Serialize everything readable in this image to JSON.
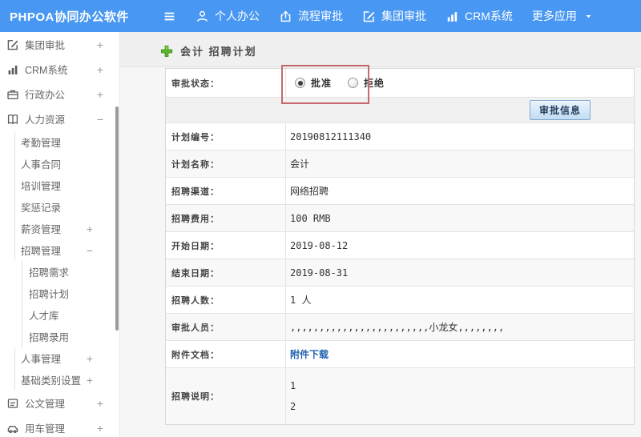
{
  "topbar": {
    "brand": "PHPOA协同办公软件",
    "menu": [
      {
        "label": "个人办公",
        "icon": "user-icon"
      },
      {
        "label": "流程审批",
        "icon": "workflow-icon"
      },
      {
        "label": "集团审批",
        "icon": "edit-square-icon"
      },
      {
        "label": "CRM系统",
        "icon": "bar-chart-icon"
      },
      {
        "label": "更多应用",
        "icon": "caret-down-icon"
      }
    ]
  },
  "sidebar": {
    "items": [
      {
        "label": "集团审批",
        "level": 1,
        "icon": "edit-square-icon",
        "toggle": "+"
      },
      {
        "label": "CRM系统",
        "level": 1,
        "icon": "bar-chart-icon",
        "toggle": "+"
      },
      {
        "label": "行政办公",
        "level": 1,
        "icon": "briefcase-icon",
        "toggle": "+"
      },
      {
        "label": "人力资源",
        "level": 1,
        "icon": "book-icon",
        "toggle": "−"
      },
      {
        "label": "考勤管理",
        "level": 2,
        "toggle": ""
      },
      {
        "label": "人事合同",
        "level": 2,
        "toggle": ""
      },
      {
        "label": "培训管理",
        "level": 2,
        "toggle": ""
      },
      {
        "label": "奖惩记录",
        "level": 2,
        "toggle": ""
      },
      {
        "label": "薪资管理",
        "level": 2,
        "toggle": "+"
      },
      {
        "label": "招聘管理",
        "level": 2,
        "toggle": "−"
      },
      {
        "label": "招聘需求",
        "level": 3,
        "toggle": ""
      },
      {
        "label": "招聘计划",
        "level": 3,
        "toggle": ""
      },
      {
        "label": "人才库",
        "level": 3,
        "toggle": ""
      },
      {
        "label": "招聘录用",
        "level": 3,
        "toggle": ""
      },
      {
        "label": "人事管理",
        "level": 2,
        "toggle": "+"
      },
      {
        "label": "基础类别设置",
        "level": 2,
        "toggle": "+"
      },
      {
        "label": "公文管理",
        "level": 1,
        "icon": "document-icon",
        "toggle": "+"
      },
      {
        "label": "用车管理",
        "level": 1,
        "icon": "car-icon",
        "toggle": "+"
      }
    ]
  },
  "main": {
    "title": "会计 招聘计划",
    "status": {
      "label": "审批状态：",
      "options": [
        {
          "label": "批准",
          "selected": true
        },
        {
          "label": "拒绝",
          "selected": false
        }
      ]
    },
    "approve_info_button": "审批信息",
    "rows": [
      {
        "label": "计划编号：",
        "value": "20190812111340"
      },
      {
        "label": "计划名称：",
        "value": "会计"
      },
      {
        "label": "招聘渠道：",
        "value": "网络招聘"
      },
      {
        "label": "招聘费用：",
        "value": "100 RMB"
      },
      {
        "label": "开始日期：",
        "value": "2019-08-12"
      },
      {
        "label": "结束日期：",
        "value": "2019-08-31"
      },
      {
        "label": "招聘人数：",
        "value": "1 人"
      },
      {
        "label": "审批人员：",
        "value": ",,,,,,,,,,,,,,,,,,,,,,,,小龙女,,,,,,,,"
      },
      {
        "label": "附件文档：",
        "value": "附件下载",
        "link": true
      },
      {
        "label": "招聘说明：",
        "lines": [
          "1",
          "2"
        ]
      }
    ]
  },
  "colors": {
    "topbar_blue": "#4897f2",
    "accent_green": "#5cb62e",
    "annotation_red": "#c76a6e",
    "link_blue": "#2465b0"
  }
}
